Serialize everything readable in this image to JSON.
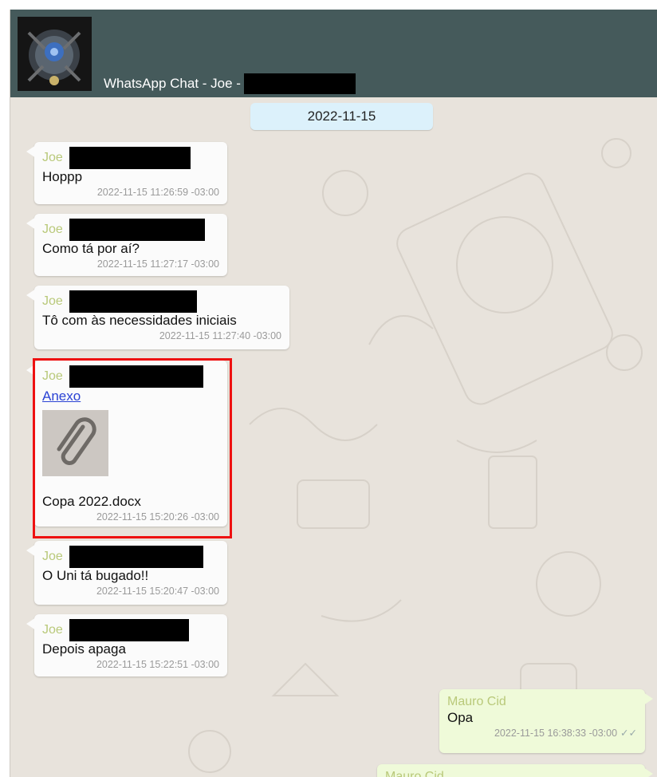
{
  "header": {
    "title": "WhatsApp Chat - Joe -"
  },
  "date_separator": "2022-11-15",
  "messages": [
    {
      "sender": "Joe",
      "text": "Hoppp",
      "timestamp": "2022-11-15 11:26:59 -03:00"
    },
    {
      "sender": "Joe",
      "text": "Como tá por aí?",
      "timestamp": "2022-11-15 11:27:17 -03:00"
    },
    {
      "sender": "Joe",
      "text": "Tô com às necessidades iniciais",
      "timestamp": "2022-11-15 11:27:40 -03:00"
    },
    {
      "sender": "Joe",
      "link": "Anexo",
      "attachment_icon": "paperclip-icon",
      "text": "Copa 2022.docx",
      "timestamp": "2022-11-15 15:20:26 -03:00"
    },
    {
      "sender": "Joe",
      "text": "O Uni tá bugado!!",
      "timestamp": "2022-11-15 15:20:47 -03:00"
    },
    {
      "sender": "Joe",
      "text": "Depois apaga",
      "timestamp": "2022-11-15 15:22:51 -03:00"
    },
    {
      "sender": "Mauro Cid",
      "text": "Opa",
      "timestamp": "2022-11-15 16:38:33 -03:00",
      "status_icon": "double-check-icon"
    },
    {
      "sender": "Mauro Cid"
    }
  ],
  "colors": {
    "header_bg": "#455a5b",
    "chat_bg": "#e8e3dc",
    "incoming_bubble": "#fbfbfb",
    "outgoing_bubble": "#effad9",
    "sender_name": "#b9c97a",
    "date_chip": "#dcf1fb",
    "highlight_border": "#ee1111",
    "link": "#2a42d4"
  }
}
